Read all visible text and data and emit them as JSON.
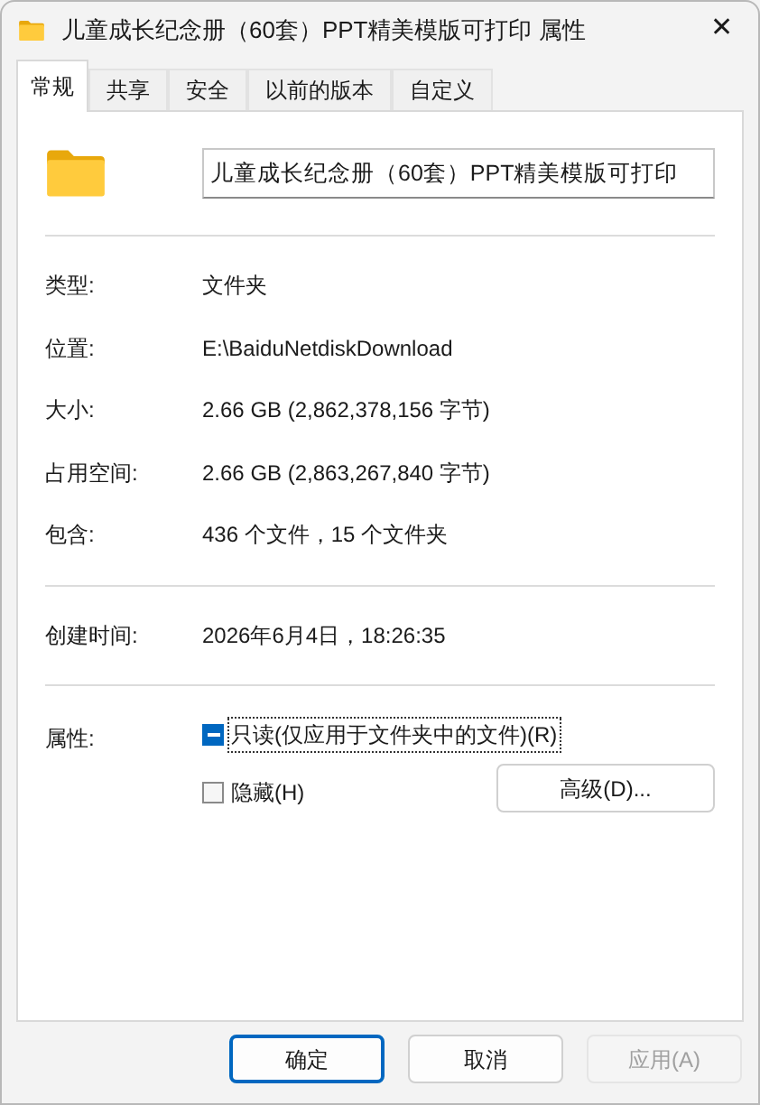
{
  "window": {
    "title": "儿童成长纪念册（60套）PPT精美模版可打印 属性",
    "close": "✕"
  },
  "tabs": [
    {
      "label": "常规",
      "selected": true
    },
    {
      "label": "共享",
      "selected": false
    },
    {
      "label": "安全",
      "selected": false
    },
    {
      "label": "以前的版本",
      "selected": false
    },
    {
      "label": "自定义",
      "selected": false
    }
  ],
  "name_field": {
    "value": "儿童成长纪念册（60套）PPT精美模版可打印"
  },
  "groups": [
    [
      {
        "label": "类型:",
        "value": "文件夹"
      },
      {
        "label": "位置:",
        "value": "E:\\BaiduNetdiskDownload"
      },
      {
        "label": "大小:",
        "value": "2.66 GB (2,862,378,156 字节)"
      },
      {
        "label": "占用空间:",
        "value": "2.66 GB (2,863,267,840 字节)"
      },
      {
        "label": "包含:",
        "value": "436 个文件，15 个文件夹"
      }
    ],
    [
      {
        "label": "创建时间:",
        "value": "2026年6月4日，18:26:35"
      }
    ]
  ],
  "attributes": {
    "label": "属性:",
    "readonly": {
      "label": "只读(仅应用于文件夹中的文件)(R)",
      "indeterminate": true,
      "focused": true
    },
    "hidden": {
      "label": "隐藏(H)",
      "checked": false,
      "focused": false
    },
    "advanced_button": "高级(D)..."
  },
  "buttons": [
    {
      "label": "确定",
      "default": true,
      "disabled": false
    },
    {
      "label": "取消",
      "default": false,
      "disabled": false
    },
    {
      "label": "应用(A)",
      "default": false,
      "disabled": true
    }
  ]
}
